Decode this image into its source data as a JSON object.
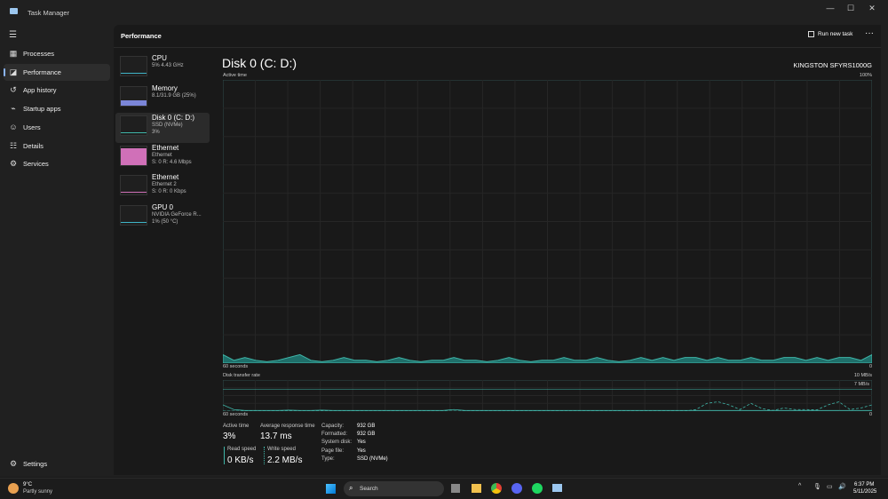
{
  "window": {
    "title": "Task Manager",
    "minimize": "—",
    "maximize": "☐",
    "close": "✕"
  },
  "nav": {
    "menu": "☰",
    "items": [
      {
        "label": "Processes",
        "icon": "▦"
      },
      {
        "label": "Performance",
        "icon": "◪",
        "active": true
      },
      {
        "label": "App history",
        "icon": "↺"
      },
      {
        "label": "Startup apps",
        "icon": "⌁"
      },
      {
        "label": "Users",
        "icon": "☺"
      },
      {
        "label": "Details",
        "icon": "☷"
      },
      {
        "label": "Services",
        "icon": "⚙"
      }
    ],
    "settings": {
      "label": "Settings",
      "icon": "⚙"
    }
  },
  "header": {
    "title": "Performance",
    "run_new_task": "Run new task",
    "more": "···"
  },
  "devices": [
    {
      "name": "CPU",
      "l1": "5% 4.43 GHz",
      "l2": "",
      "color": "#3fb5c8"
    },
    {
      "name": "Memory",
      "l1": "8.1/31.9 GB (25%)",
      "l2": "",
      "color": "#7b86d8"
    },
    {
      "name": "Disk 0 (C: D:)",
      "l1": "SSD (NVMe)",
      "l2": "3%",
      "color": "#3fb5a8"
    },
    {
      "name": "Ethernet",
      "l1": "Ethernet",
      "l2": "S: 0 R: 4.6 Mbps",
      "color": "#d070b8"
    },
    {
      "name": "Ethernet",
      "l1": "Ethernet 2",
      "l2": "S: 0 R: 0 Kbps",
      "color": "#d070b8"
    },
    {
      "name": "GPU 0",
      "l1": "NVIDIA GeForce R...",
      "l2": "1% (50 °C)",
      "color": "#3fb5c8"
    }
  ],
  "detail": {
    "title": "Disk 0 (C: D:)",
    "model": "KINGSTON SFYRS1000G",
    "active": {
      "label": "Active time",
      "max": "100%",
      "xleft": "60 seconds",
      "xright": "0",
      "values": [
        3,
        1,
        2,
        1,
        0.5,
        1,
        2,
        3,
        1,
        0.5,
        1,
        2,
        1,
        1,
        0.5,
        1,
        2,
        1,
        0.5,
        1,
        1,
        2,
        1,
        1,
        0.5,
        1,
        2,
        1,
        0.5,
        1,
        1,
        2,
        1,
        1,
        2,
        1,
        0.5,
        1,
        2,
        1,
        2,
        1,
        2,
        2,
        1,
        2,
        1,
        1,
        2,
        1,
        1,
        2,
        2,
        1,
        2,
        1,
        2,
        2,
        1,
        3
      ]
    },
    "transfer": {
      "label": "Disk transfer rate",
      "max": "10 MB/s",
      "mid": "7 MB/s",
      "xleft": "60 seconds",
      "xright": "0",
      "read": [
        20,
        5,
        2,
        2,
        2,
        2,
        3,
        2,
        2,
        3,
        2,
        2,
        2,
        2,
        2,
        2,
        2,
        2,
        2,
        2,
        2,
        5,
        2,
        2,
        2,
        2,
        2,
        2,
        2,
        2,
        2,
        2,
        2,
        2,
        2,
        2,
        2,
        2,
        2,
        2,
        2,
        2,
        2,
        2,
        2,
        2,
        2,
        2,
        2,
        2,
        2,
        2,
        2,
        2,
        2,
        2,
        2,
        2,
        2,
        2
      ],
      "write": [
        0,
        0,
        0,
        0,
        0,
        0,
        0,
        0,
        0,
        0,
        0,
        0,
        0,
        0,
        0,
        0,
        0,
        0,
        0,
        0,
        0,
        0,
        0,
        0,
        0,
        0,
        0,
        0,
        0,
        0,
        0,
        0,
        0,
        0,
        0,
        0,
        0,
        0,
        0,
        0,
        0,
        0,
        0,
        5,
        25,
        30,
        20,
        5,
        25,
        8,
        2,
        10,
        5,
        5,
        4,
        20,
        30,
        5,
        10,
        20
      ]
    },
    "stats": {
      "active_label": "Active time",
      "active": "3%",
      "resp_label": "Average response time",
      "resp": "13.7 ms",
      "read_label": "Read speed",
      "read": "0 KB/s",
      "write_label": "Write speed",
      "write": "2.2 MB/s"
    },
    "props": [
      [
        "Capacity:",
        "932 GB"
      ],
      [
        "Formatted:",
        "932 GB"
      ],
      [
        "System disk:",
        "Yes"
      ],
      [
        "Page file:",
        "Yes"
      ],
      [
        "Type:",
        "SSD (NVMe)"
      ]
    ]
  },
  "taskbar": {
    "temp": "9°C",
    "weather": "Partly sunny",
    "search": "Search",
    "time": "6:37 PM",
    "date": "5/11/2025"
  }
}
